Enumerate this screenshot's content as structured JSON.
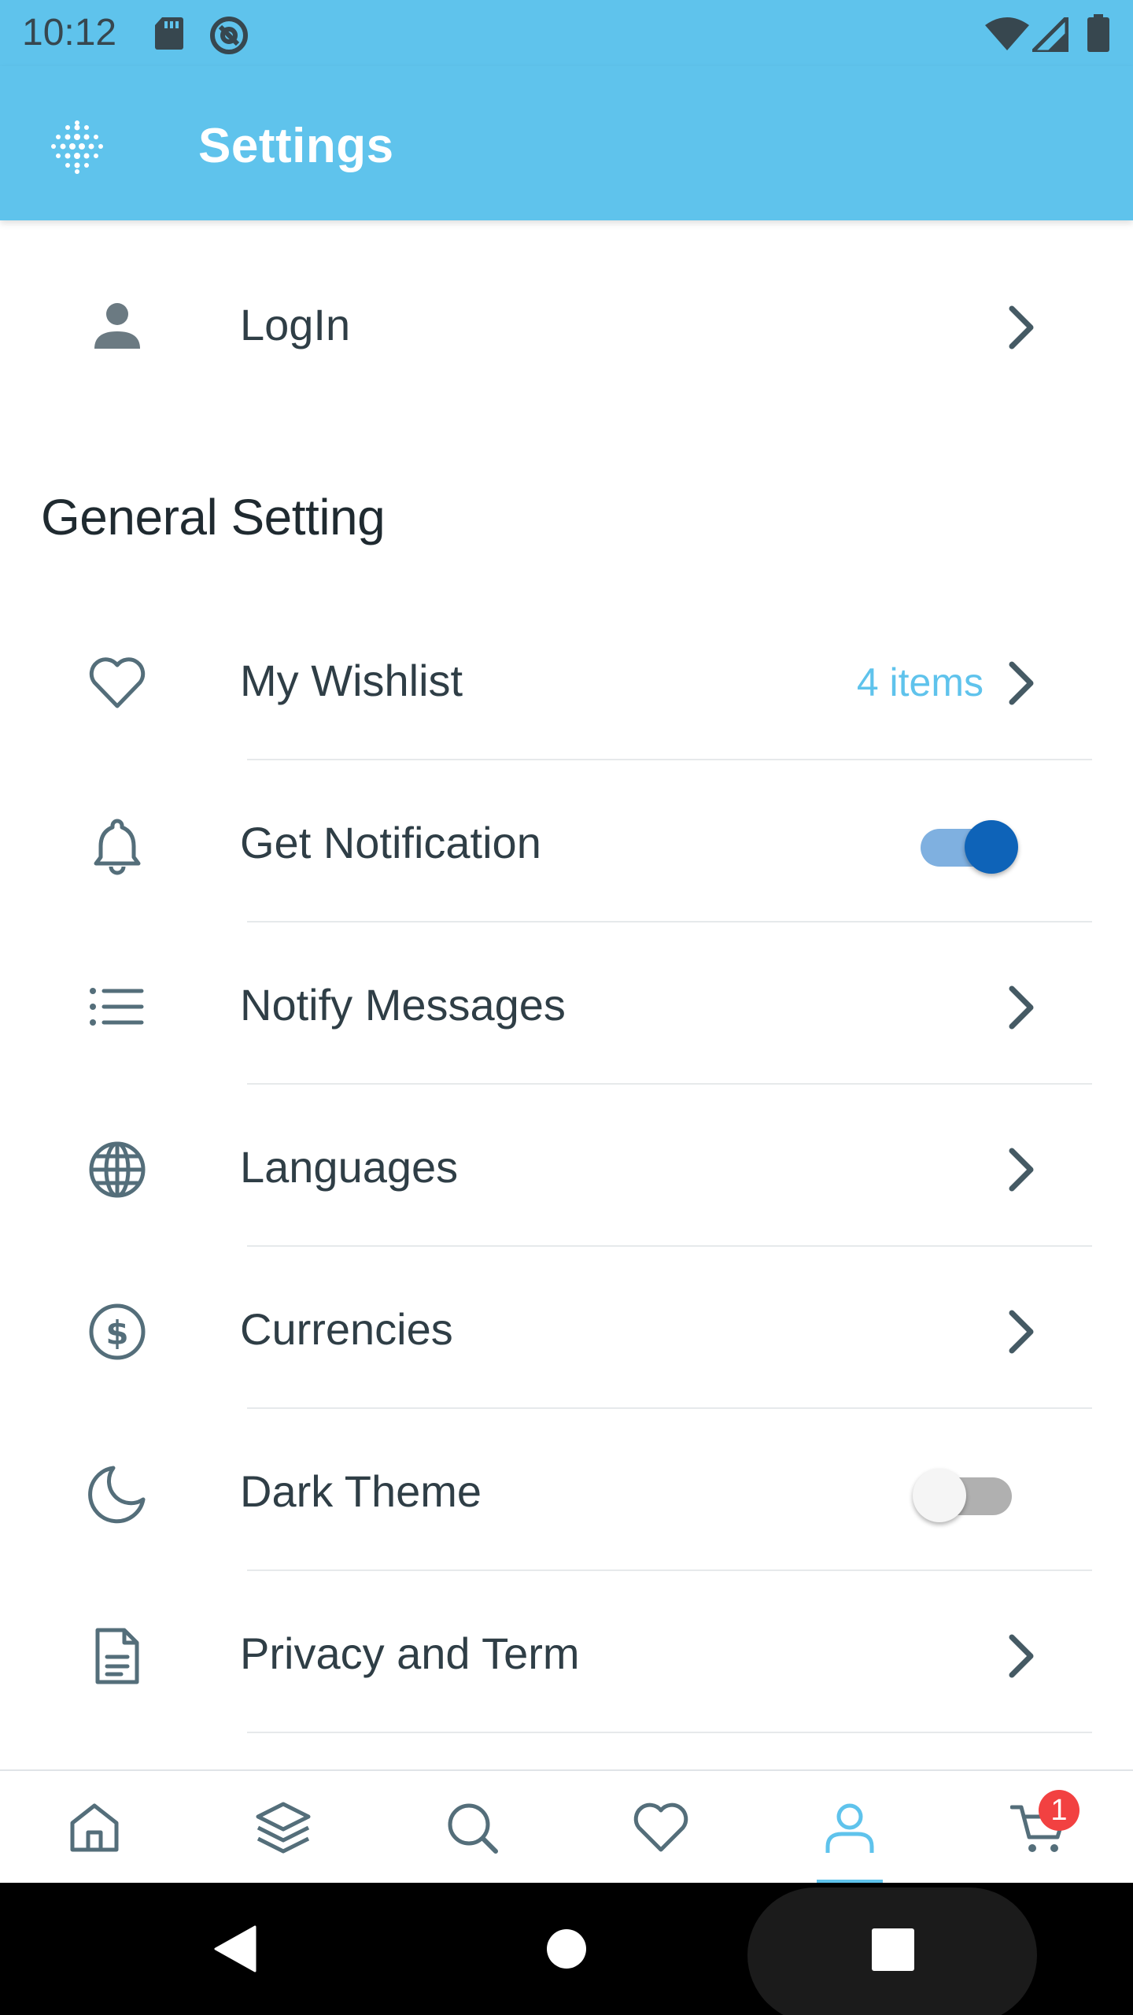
{
  "status_bar": {
    "time": "10:12",
    "left_icons": [
      "sd-card-icon",
      "at-sign-icon"
    ],
    "right_icons": [
      "wifi-icon",
      "cellular-signal-icon",
      "battery-icon"
    ]
  },
  "app_bar": {
    "title": "Settings",
    "logo_icon": "dotted-grid-logo-icon",
    "background_color": "#5fc3ec"
  },
  "login_row": {
    "label": "LogIn",
    "icon": "person-icon"
  },
  "general_section": {
    "title": "General Setting",
    "items": [
      {
        "label": "My Wishlist",
        "icon": "heart-icon",
        "value": "4 items",
        "control": "chevron"
      },
      {
        "label": "Get Notification",
        "icon": "bell-icon",
        "control": "toggle",
        "toggle_on": true
      },
      {
        "label": "Notify Messages",
        "icon": "list-icon",
        "control": "chevron"
      },
      {
        "label": "Languages",
        "icon": "globe-icon",
        "control": "chevron"
      },
      {
        "label": "Currencies",
        "icon": "dollar-circle-icon",
        "control": "chevron"
      },
      {
        "label": "Dark Theme",
        "icon": "moon-icon",
        "control": "toggle",
        "toggle_on": false
      },
      {
        "label": "Privacy and Term",
        "icon": "document-icon",
        "control": "chevron"
      }
    ]
  },
  "bottom_nav": {
    "items": [
      {
        "icon": "home-icon",
        "active": false
      },
      {
        "icon": "layers-icon",
        "active": false
      },
      {
        "icon": "search-icon",
        "active": false
      },
      {
        "icon": "heart-icon",
        "active": false
      },
      {
        "icon": "user-icon",
        "active": true
      },
      {
        "icon": "cart-icon",
        "active": false
      }
    ],
    "cart_badge": "1",
    "active_color": "#5fc3ec",
    "inactive_color": "#546e7a",
    "badge_color": "#f24141"
  },
  "system_nav": {
    "buttons": [
      "back-triangle-icon",
      "home-circle-icon",
      "recents-square-icon"
    ]
  },
  "colors": {
    "accent": "#5fc3ec",
    "text": "#2f3e46",
    "icon": "#546e7a",
    "toggle_on_thumb": "#0e63b8",
    "toggle_on_track": "#7fb0e0"
  }
}
